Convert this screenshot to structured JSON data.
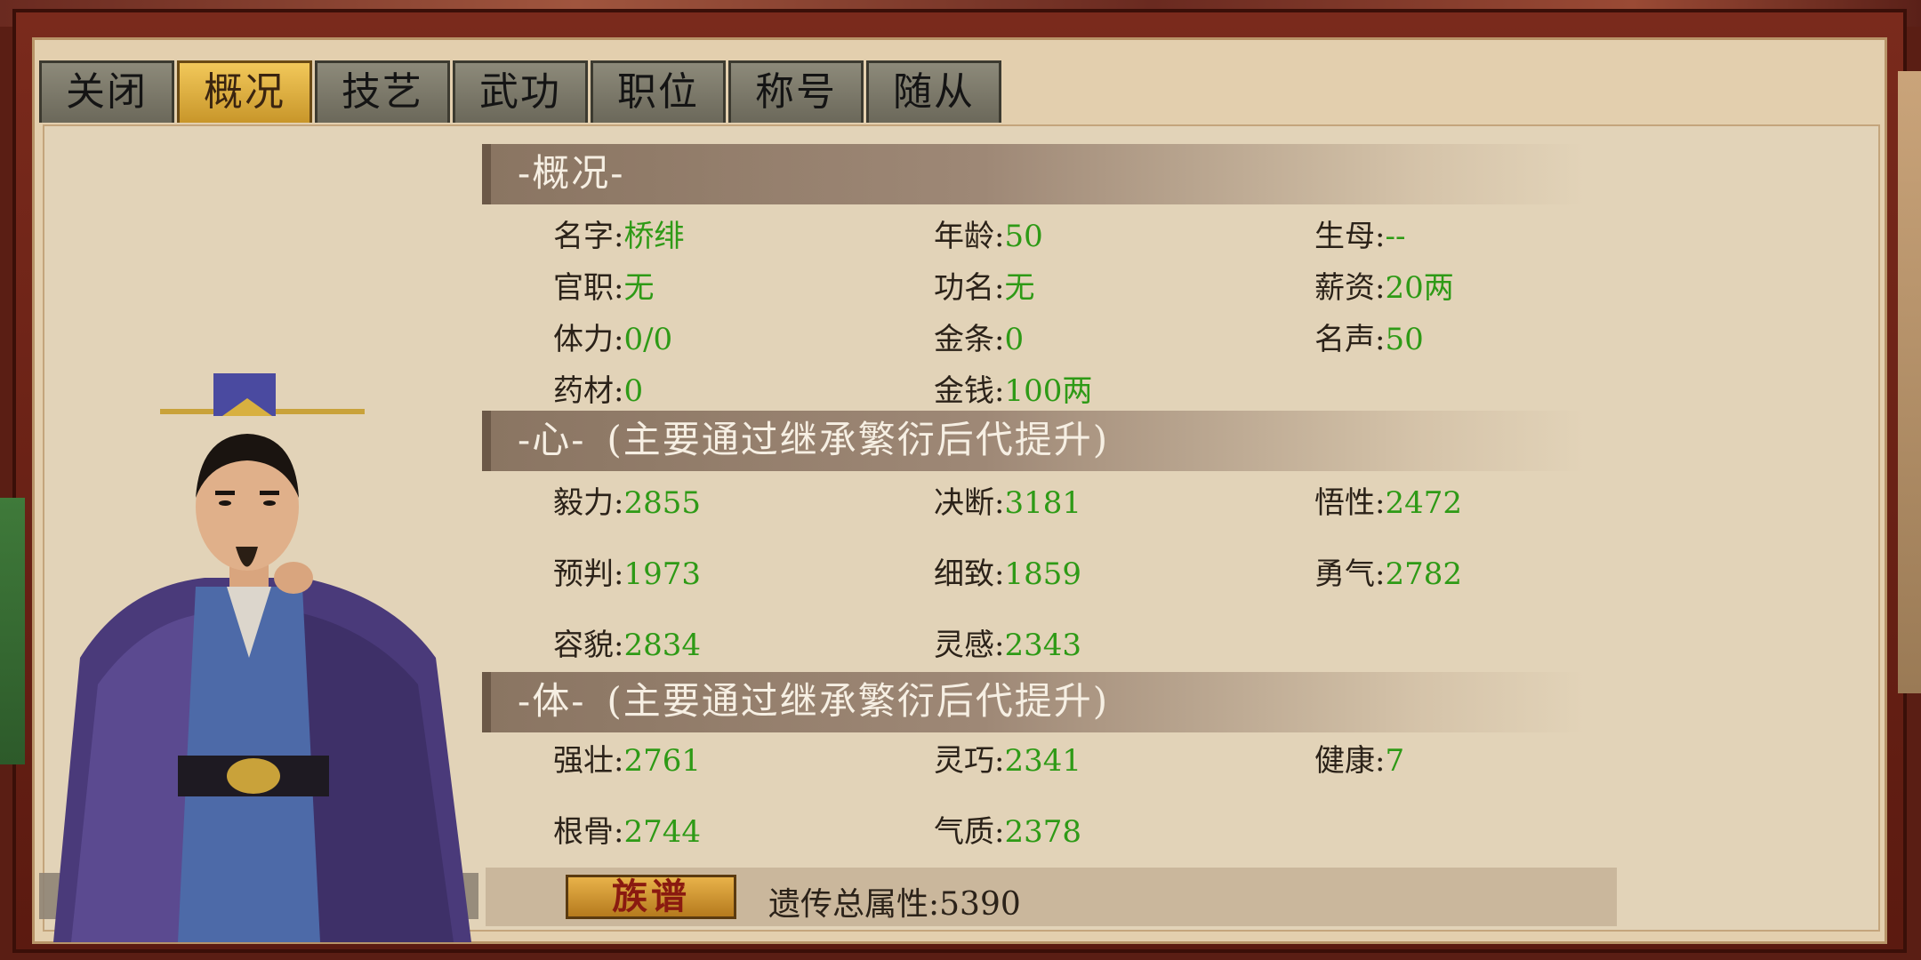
{
  "tabs": [
    "关闭",
    "概况",
    "技艺",
    "武功",
    "职位",
    "称号",
    "随从"
  ],
  "active_tab": 1,
  "overview": {
    "title": "-概况-",
    "rows": [
      [
        {
          "k": "名字:",
          "v": "桥绯"
        },
        {
          "k": "年龄:",
          "v": "50"
        },
        {
          "k": "生母:",
          "v": "--"
        }
      ],
      [
        {
          "k": "官职:",
          "v": "无"
        },
        {
          "k": "功名:",
          "v": "无"
        },
        {
          "k": "薪资:",
          "v": "20两"
        }
      ],
      [
        {
          "k": "体力:",
          "v": "0/0"
        },
        {
          "k": "金条:",
          "v": "0"
        },
        {
          "k": "名声:",
          "v": "50"
        }
      ],
      [
        {
          "k": "药材:",
          "v": "0"
        },
        {
          "k": "金钱:",
          "v": "100两"
        }
      ]
    ]
  },
  "heart": {
    "title": "-心-",
    "subtitle": "(主要通过继承繁衍后代提升)",
    "rows": [
      [
        {
          "k": "毅力:",
          "v": "2855"
        },
        {
          "k": "决断:",
          "v": "3181"
        },
        {
          "k": "悟性:",
          "v": "2472"
        }
      ],
      [
        {
          "k": "预判:",
          "v": "1973"
        },
        {
          "k": "细致:",
          "v": "1859"
        },
        {
          "k": "勇气:",
          "v": "2782"
        }
      ],
      [
        {
          "k": "容貌:",
          "v": "2834"
        },
        {
          "k": "灵感:",
          "v": "2343"
        }
      ]
    ]
  },
  "body": {
    "title": "-体-",
    "subtitle": "(主要通过继承繁衍后代提升)",
    "rows": [
      [
        {
          "k": "强壮:",
          "v": "2761"
        },
        {
          "k": "灵巧:",
          "v": "2341"
        },
        {
          "k": "健康:",
          "v": "7"
        }
      ],
      [
        {
          "k": "根骨:",
          "v": "2744"
        },
        {
          "k": "气质:",
          "v": "2378"
        }
      ]
    ]
  },
  "footer": {
    "clan_button": "族谱",
    "genetic_label": "遗传总属性:",
    "genetic_value": "5390"
  },
  "colors": {
    "value_green": "#2e9a16",
    "accent_gold": "#e8b24a"
  }
}
